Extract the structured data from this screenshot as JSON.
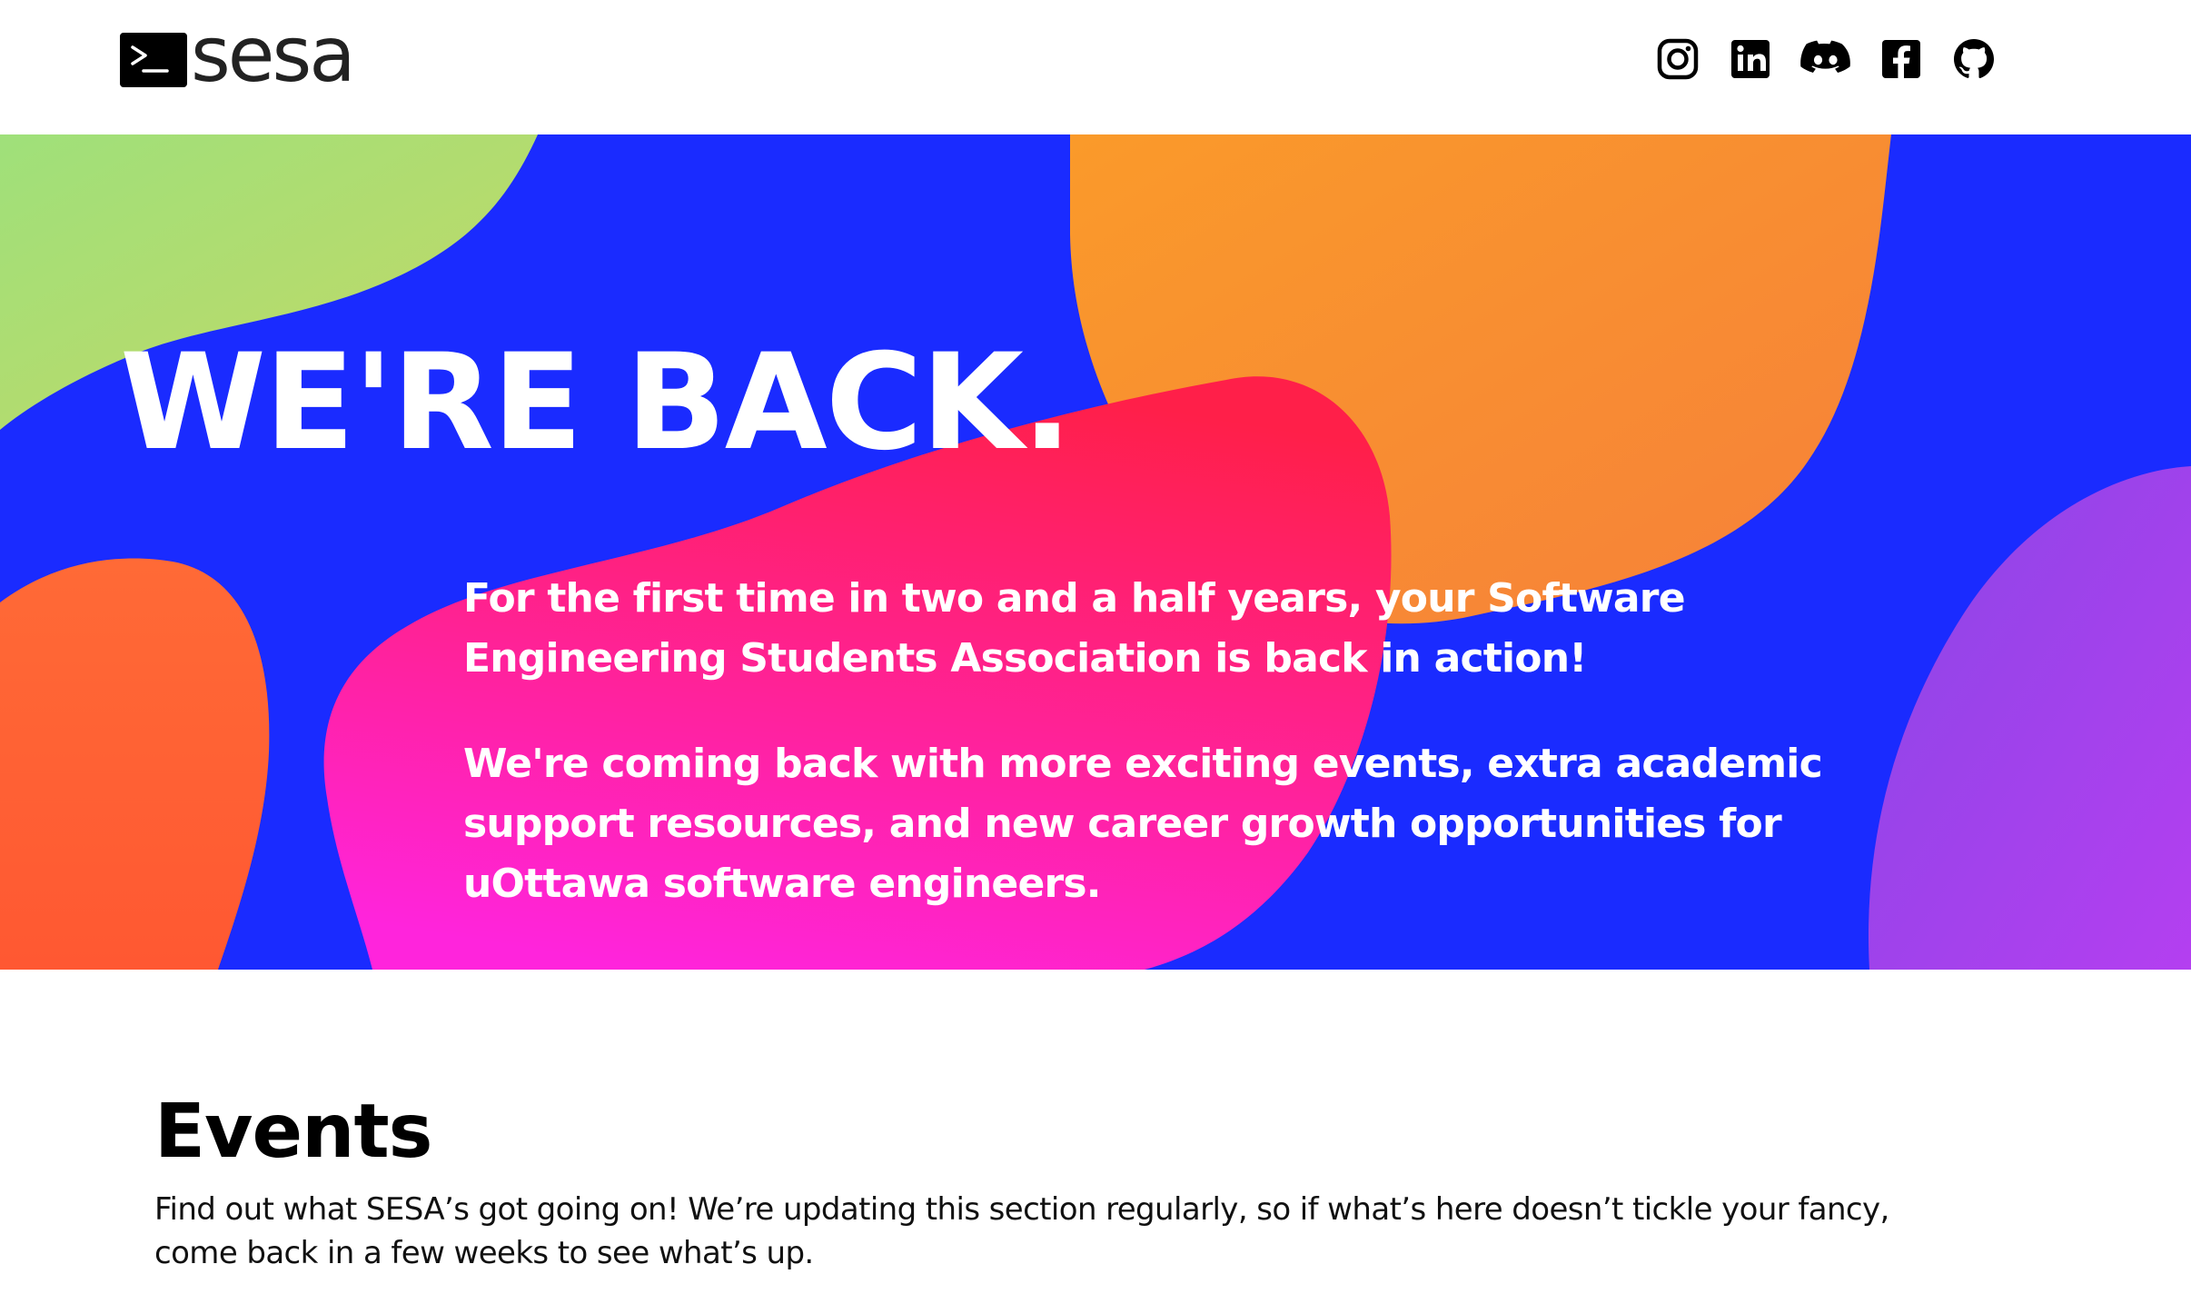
{
  "header": {
    "logo_text": "sesa",
    "social_links": [
      {
        "icon": "instagram-icon",
        "label": "Instagram"
      },
      {
        "icon": "linkedin-icon",
        "label": "LinkedIn"
      },
      {
        "icon": "discord-icon",
        "label": "Discord"
      },
      {
        "icon": "facebook-icon",
        "label": "Facebook"
      },
      {
        "icon": "github-icon",
        "label": "GitHub"
      }
    ]
  },
  "hero": {
    "title": "WE'RE BACK.",
    "paragraphs": [
      "For the first time in two and a half years, your Software Engineering Students Association is back in action!",
      "We're coming back with more exciting events, extra academic support resources, and new career growth opportunities for uOttawa software engineers."
    ],
    "colors": {
      "background": "#1a2bff",
      "blob_green": "#a8dd6f",
      "blob_orange": "#f78f32",
      "blob_pink_top": "#ff2157",
      "blob_pink_bottom": "#ff22d8",
      "blob_red_orange": "#ff5b34",
      "blob_purple": "#9845ea"
    }
  },
  "events": {
    "title": "Events",
    "description": "Find out what SESA’s got going on! We’re updating this section regularly, so if what’s here doesn’t tickle your fancy, come back in a few weeks to see what’s up."
  }
}
